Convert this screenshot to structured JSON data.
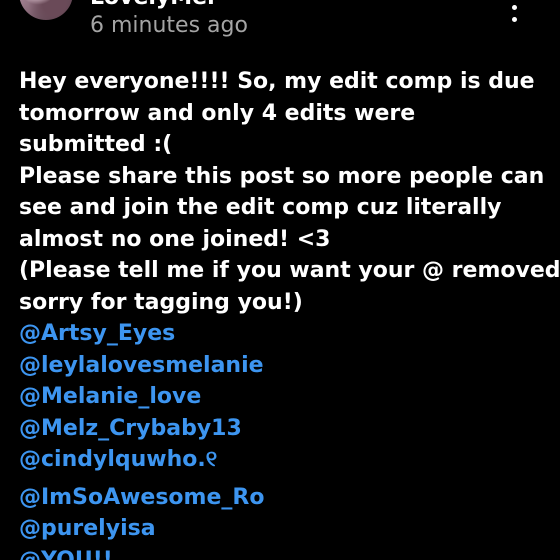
{
  "post": {
    "username": "LovelyMel",
    "timestamp": "6 minutes ago",
    "body_lines": [
      "Hey everyone!!!! So, my edit comp is due",
      "tomorrow and only 4 edits were",
      "submitted :(",
      "Please share this post so more people can",
      "see and join the edit comp cuz literally",
      "almost no one joined! <3",
      "(Please tell me if you want your @ removed,",
      "sorry for tagging you!)"
    ],
    "mentions": [
      "@Artsy_Eyes",
      "@leylalovesmelanie",
      "@Melanie_love",
      "@Melz_Crybaby13",
      "@cindylquwho.୧",
      "@ImSoAwesome_Ro",
      "@purelyisa",
      "@YOU!!"
    ]
  },
  "icons": {
    "more": "more-vertical-icon",
    "avatar": "avatar"
  },
  "colors": {
    "background": "#000000",
    "text": "#ffffff",
    "timestamp": "#a4a4a4",
    "mention": "#3d95f0"
  }
}
